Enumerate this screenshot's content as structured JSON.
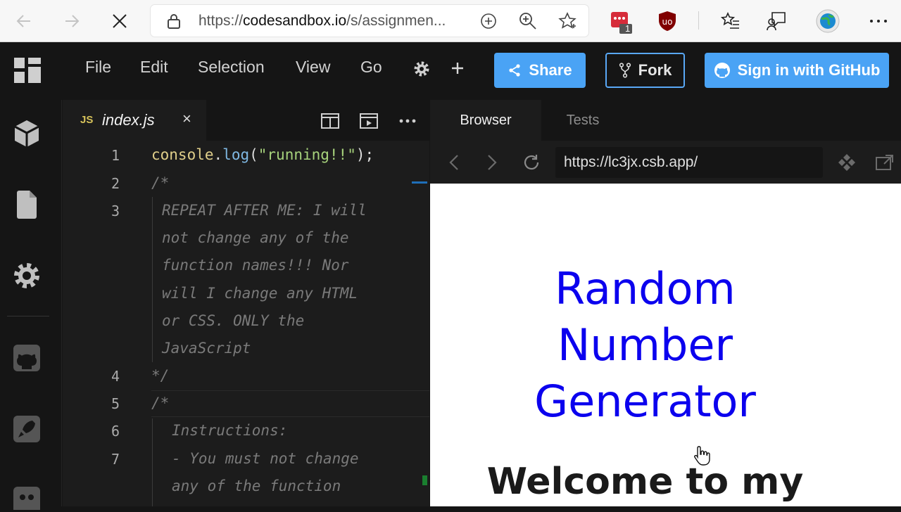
{
  "browser": {
    "url_prefix": "https://",
    "url_domain": "codesandbox.io",
    "url_rest": "/s/assignmen...",
    "ext_badge": "1",
    "icons": [
      "back-arrow-icon",
      "forward-arrow-icon",
      "close-icon",
      "lock-icon",
      "add-circle-icon",
      "zoom-icon",
      "star-icon",
      "favorites-icon",
      "feedback-icon",
      "globe-icon",
      "more-icon"
    ]
  },
  "header": {
    "menu": [
      "File",
      "Edit",
      "Selection",
      "View",
      "Go"
    ],
    "share_label": "Share",
    "fork_label": "Fork",
    "github_label": "Sign in with GitHub",
    "accent_color": "#4aa3f5"
  },
  "editor": {
    "tab_lang": "JS",
    "tab_name": "index.js",
    "tab_close": "×",
    "lines": [
      {
        "n": "1",
        "text_obj": "console",
        "text_dot": ".",
        "text_fn": "log",
        "text_open": "(",
        "text_str": "\"running!!\"",
        "text_close": ");"
      },
      {
        "n": "2",
        "text": "/*"
      },
      {
        "n": "3",
        "wrapped": [
          "REPEAT AFTER ME: I will",
          "not change any of the",
          "function names!!! Nor",
          "will I change any HTML",
          "or CSS. ONLY the",
          "JavaScript"
        ]
      },
      {
        "n": "4",
        "text": "*/"
      },
      {
        "n": "5",
        "text": "/*"
      },
      {
        "n": "6",
        "text": "Instructions:"
      },
      {
        "n": "7",
        "wrapped": [
          "- You must not change",
          "any of the function"
        ]
      }
    ]
  },
  "preview": {
    "tab_browser": "Browser",
    "tab_tests": "Tests",
    "address": "https://lc3jx.csb.app/",
    "title_lines": [
      "Random",
      "Number",
      "Generator"
    ],
    "welcome": "Welcome to my"
  }
}
